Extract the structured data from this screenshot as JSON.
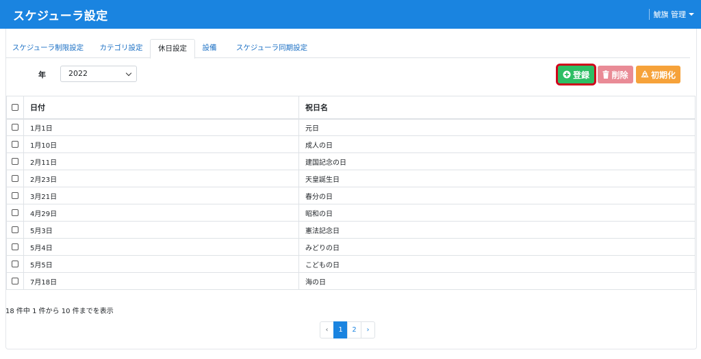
{
  "header": {
    "title": "スケジューラ設定",
    "user": "鯱旗 管理"
  },
  "tabs": [
    {
      "label": "スケジューラ制限設定",
      "active": false
    },
    {
      "label": "カテゴリ設定",
      "active": false
    },
    {
      "label": "休日設定",
      "active": true
    },
    {
      "label": "設備",
      "active": false
    },
    {
      "label": "スケジューラ同期設定",
      "active": false
    }
  ],
  "filter": {
    "year_label": "年",
    "year_value": "2022"
  },
  "toolbar": {
    "register_label": "登録",
    "delete_label": "削除",
    "reset_label": "初期化"
  },
  "colors": {
    "header_bg": "#1a84e0",
    "register": "#2dbe64",
    "delete": "#e98b96",
    "reset": "#f6a23a",
    "highlight": "#d0001b"
  },
  "table": {
    "columns": [
      "日付",
      "祝日名"
    ],
    "rows": [
      {
        "date": "1月1日",
        "name": "元日"
      },
      {
        "date": "1月10日",
        "name": "成人の日"
      },
      {
        "date": "2月11日",
        "name": "建国記念の日"
      },
      {
        "date": "2月23日",
        "name": "天皇誕生日"
      },
      {
        "date": "3月21日",
        "name": "春分の日"
      },
      {
        "date": "4月29日",
        "name": "昭和の日"
      },
      {
        "date": "5月3日",
        "name": "憲法記念日"
      },
      {
        "date": "5月4日",
        "name": "みどりの日"
      },
      {
        "date": "5月5日",
        "name": "こどもの日"
      },
      {
        "date": "7月18日",
        "name": "海の日"
      }
    ]
  },
  "summary": "18 件中 1 件から 10 件までを表示",
  "pagination": {
    "prev": "‹",
    "pages": [
      "1",
      "2"
    ],
    "current": "1",
    "next": "›"
  }
}
